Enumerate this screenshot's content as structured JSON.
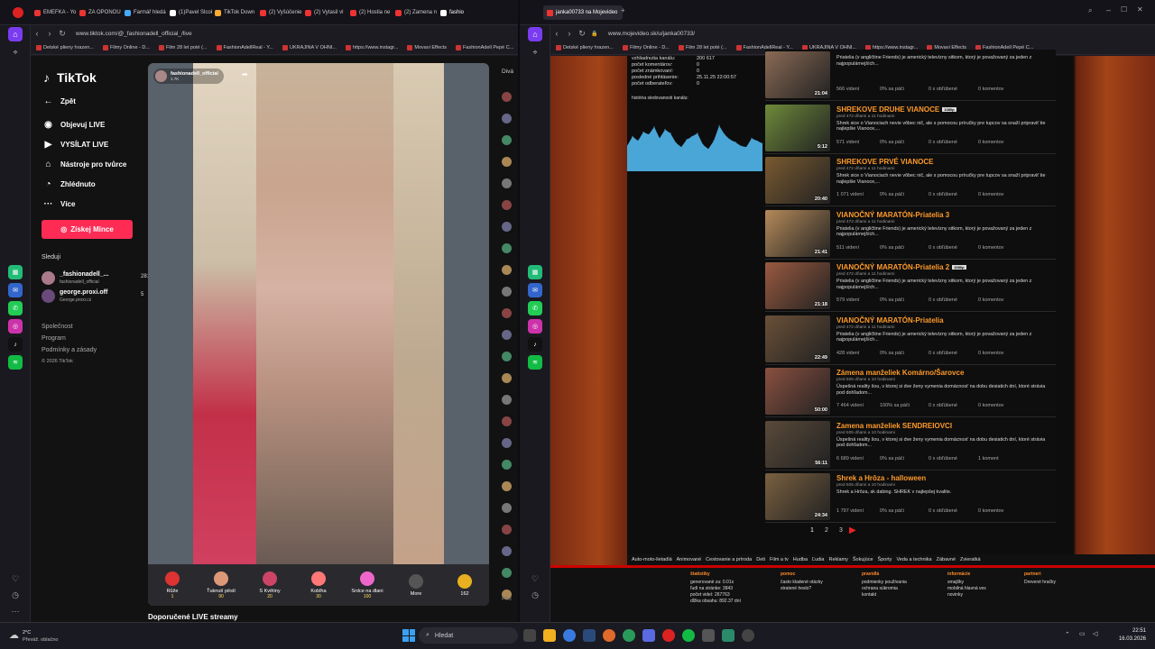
{
  "left_window": {
    "tabs": [
      {
        "label": "EMEFKA - Yo",
        "color": "#e33"
      },
      {
        "label": "ZA OPONOU",
        "color": "#e33"
      },
      {
        "label": "Farmář hledá",
        "color": "#4af"
      },
      {
        "label": "(1)Pavel Slcok",
        "color": "#fff"
      },
      {
        "label": "TikTok Down",
        "color": "#fa3"
      },
      {
        "label": "(2) Vyšúčenie",
        "color": "#e33"
      },
      {
        "label": "(2) Vytasil vl",
        "color": "#e33"
      },
      {
        "label": "(2) Hostia ne",
        "color": "#e33"
      },
      {
        "label": "(2) Zamena n",
        "color": "#e33"
      },
      {
        "label": "fashio",
        "color": "#fff"
      }
    ],
    "url": "www.tiktok.com/@_fashionadell_official_/live",
    "bookmarks": [
      "Detské plieny hrazen...",
      "Filmy Online - D...",
      "Film 28 let poté (...",
      "FashionAdellReal - Y...",
      "UKRAJINA V OHNI...",
      "https://www.instagr...",
      "Movavi Effects",
      "FashionAdell Pepé C..."
    ]
  },
  "tiktok": {
    "logo": "TikTok",
    "back": "Zpět",
    "nav": [
      {
        "label": "Objevuj LIVE",
        "icon": "explore-icon"
      },
      {
        "label": "VYSÍLAT LIVE",
        "icon": "camera-icon"
      },
      {
        "label": "Nástroje pro tvůrce",
        "icon": "tools-icon"
      },
      {
        "label": "Zhlédnuto",
        "icon": "history-icon"
      },
      {
        "label": "Více",
        "icon": "more-icon"
      }
    ],
    "coins_button": "Získej Mince",
    "following_title": "Sleduji",
    "following": [
      {
        "name": "_fashionadell_...",
        "sub": "fashionadell_official",
        "count": "281"
      },
      {
        "name": "george.proxi.off",
        "sub": "George.proxi.cz",
        "count": "5"
      }
    ],
    "footer": [
      "Společnost",
      "Program",
      "Podmínky a zásady",
      "© 2026 TikTok"
    ],
    "host": {
      "name": "fashionadell_official",
      "likes": "1.7K"
    },
    "gifts": [
      {
        "name": "Růže",
        "price": "1"
      },
      {
        "name": "Ťuknutí pěstí",
        "price": "90"
      },
      {
        "name": "S Květiny",
        "price": "20"
      },
      {
        "name": "Koblha",
        "price": "30"
      },
      {
        "name": "Srdce na dlani",
        "price": "100"
      }
    ],
    "more": "More",
    "coins": "162",
    "recommended": "Doporučené LIVE streamy",
    "side_label": "Divá",
    "placeholder": "Přid"
  },
  "right_window": {
    "tab": "janka00733 na Mojevideo",
    "url": "www.mojevideo.sk/u/janka00733/",
    "bookmarks": [
      "Detské plieny hrazen...",
      "Filmy Online - D...",
      "Film 28 let poté (...",
      "FashionAdellReal - Y...",
      "UKRAJINA V OHNI...",
      "https://www.instagr...",
      "Movavi Effects",
      "FashionAdell Pepé C..."
    ]
  },
  "profile_stats": {
    "rows": [
      {
        "label": "vzhliadnutia kanálu:",
        "value": "200 617"
      },
      {
        "label": "počet komentárov:",
        "value": "0"
      },
      {
        "label": "počet známkovaní:",
        "value": "0"
      },
      {
        "label": "posledné prihlásenie:",
        "value": "25.11.25 22:00:57"
      },
      {
        "label": "počet odberateľov:",
        "value": "0"
      }
    ],
    "chart_title": "história sledovanosti kanálu:"
  },
  "chart_data": {
    "type": "area",
    "title": "história sledovanosti kanálu:",
    "xlabel": "",
    "ylabel": "",
    "values": [
      40,
      55,
      48,
      62,
      58,
      70,
      52,
      66,
      60,
      45,
      38,
      50,
      55,
      60,
      42,
      35,
      48,
      72,
      58,
      50,
      46,
      40,
      38,
      52,
      48,
      44
    ],
    "color": "#4aa6d6"
  },
  "videos": [
    {
      "title": "",
      "hd": false,
      "age": "",
      "desc": "Priatelia (v angličtine Friends) je americký televízny sitkom, ktorý je považovaný za jeden z najpopulárnejších...",
      "views": "566 videní",
      "like": "0% sa páči",
      "fav": "0 x obľúbené",
      "comments": "0 komentov",
      "duration": "21:04",
      "thumb": "#8a6a55"
    },
    {
      "title": "SHREKOVE DRUHE VIANOCE",
      "hd": true,
      "age": "pred 472 dňami a 11 hodinami",
      "desc": "Shrek sice o Vianociach nevie vôbec nič, ale s pomocou príručky pre tupcov sa snaží pripraviť tie najlepšie Vianoce,...",
      "views": "571 videní",
      "like": "0% sa páči",
      "fav": "0 x obľúbené",
      "comments": "0 komentov",
      "duration": "5:12",
      "thumb": "#6d8a3a"
    },
    {
      "title": "SHREKOVE PRVÉ VIANOCE",
      "hd": false,
      "age": "pred 472 dňami a 11 hodinami",
      "desc": "Shrek sice o Vianociach nevie vôbec nič, ale s pomocou príručky pre tupcov sa snaží pripraviť tie najlepšie Vianoce,...",
      "views": "1 071 videní",
      "like": "0% sa páči",
      "fav": "0 x obľúbené",
      "comments": "0 komentov",
      "duration": "20:40",
      "thumb": "#7a5a30"
    },
    {
      "title": "VIANOČNÝ MARATÓN-Priatelia 3",
      "hd": false,
      "age": "pred 472 dňami a 11 hodinami",
      "desc": "Priatelia (v angličtine Friends) je americký televízny sitkom, ktorý je považovaný za jeden z najpopulárnejších...",
      "views": "511 videní",
      "like": "0% sa páči",
      "fav": "0 x obľúbené",
      "comments": "0 komentov",
      "duration": "21:41",
      "thumb": "#b58a5a"
    },
    {
      "title": "VIANOČNÝ MARATÓN-Priatelia 2",
      "hd": true,
      "age": "pred 472 dňami a 11 hodinami",
      "desc": "Priatelia (v angličtine Friends) je americký televízny sitkom, ktorý je považovaný za jeden z najpopulárnejších...",
      "views": "579 videní",
      "like": "0% sa páči",
      "fav": "0 x obľúbené",
      "comments": "0 komentov",
      "duration": "21:18",
      "thumb": "#9a5a40"
    },
    {
      "title": "VIANOČNÝ MARATÓN-Priatelia",
      "hd": false,
      "age": "pred 472 dňami a 11 hodinami",
      "desc": "Priatelia (v angličtine Friends) je americký televízny sitkom, ktorý je považovaný za jeden z najpopulárnejších...",
      "views": "428 videní",
      "like": "0% sa páči",
      "fav": "0 x obľúbené",
      "comments": "0 komentov",
      "duration": "22:49",
      "thumb": "#6a5038"
    },
    {
      "title": "Zámena manželiek Komárno/Šarovce",
      "hd": false,
      "age": "pred 505 dňami a 10 hodinami",
      "desc": "Úspešná reality šou, v ktorej si dve ženy vymenia domácnosť na dobu desiatich dní, ktoré strávia pod dohľadom...",
      "views": "7 464 videní",
      "like": "100% sa páči",
      "fav": "0 x obľúbené",
      "comments": "0 komentov",
      "duration": "50:00",
      "thumb": "#8a5040"
    },
    {
      "title": "Zamena manželiek SENDREIOVCI",
      "hd": false,
      "age": "pred 505 dňami a 10 hodinami",
      "desc": "Úspešná reality šou, v ktorej si dve ženy vymenia domácnosť na dobu desiatich dní, ktoré strávia pod dohľadom...",
      "views": "6 689 videní",
      "like": "0% sa páči",
      "fav": "0 x obľúbené",
      "comments": "1 koment",
      "duration": "56:11",
      "thumb": "#5a4a3a"
    },
    {
      "title": "Shrek a Hrôza - halloween",
      "hd": false,
      "age": "pred 505 dňami a 10 hodinami",
      "desc": "Shrek a Hrôza, sk dabing. SHREK v najlepšej kvalite.",
      "views": "1 797 videní",
      "like": "0% sa páči",
      "fav": "0 x obľúbené",
      "comments": "0 komentov",
      "duration": "24:34",
      "thumb": "#7a6040"
    }
  ],
  "pagination": [
    "1",
    "2",
    "3"
  ],
  "categories": [
    "Auto-moto-lietadlá",
    "Animované",
    "Cestovanie a príroda",
    "Deti",
    "Film a tv",
    "Hudba",
    "Ľudia",
    "Reklamy",
    "Šokujúce",
    "Športy",
    "Veda a technika",
    "Zábavné",
    "Zvieratká"
  ],
  "footer": {
    "cols": [
      {
        "title": "štatistiky",
        "items": [
          "generované za: 0.01s",
          "ľudí na stránke: 3843",
          "počet videí: 267763",
          "dĺžka obsahu: 892.37 dní"
        ]
      },
      {
        "title": "pomoc",
        "items": [
          "často kladené otázky",
          "stratené heslo?"
        ]
      },
      {
        "title": "pravidlá",
        "items": [
          "podmienky používania",
          "ochrana súkromia",
          "kontakt"
        ]
      },
      {
        "title": "informácie",
        "items": [
          "smajlíky",
          "mobilná hlavná ves",
          "novinky"
        ]
      },
      {
        "title": "partneri",
        "items": [
          "Drevené hračky"
        ]
      }
    ]
  },
  "taskbar": {
    "weather_temp": "2°C",
    "weather_desc": "Převáž. oblačno",
    "search": "Hledat",
    "time": "22:51",
    "date": "16.03.2026"
  }
}
